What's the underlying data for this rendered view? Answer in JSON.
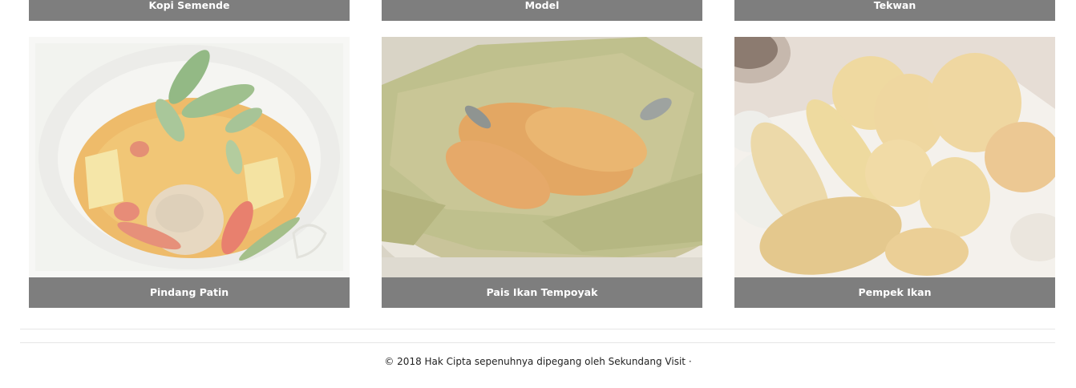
{
  "top_row": [
    {
      "title": "Kopi Semende"
    },
    {
      "title": "Model"
    },
    {
      "title": "Tekwan"
    }
  ],
  "cards": [
    {
      "title": "Pindang Patin",
      "image": "pindang-patin-photo"
    },
    {
      "title": "Pais Ikan Tempoyak",
      "image": "pais-ikan-tempoyak-photo"
    },
    {
      "title": "Pempek Ikan",
      "image": "pempek-ikan-photo"
    }
  ],
  "footer": {
    "text": "© 2018 Hak Cipta sepenuhnya dipegang oleh Sekundang Visit ·"
  },
  "colors": {
    "caption_bg": "#7e7e7e",
    "caption_text": "#ffffff",
    "divider": "#e6e6e6"
  }
}
